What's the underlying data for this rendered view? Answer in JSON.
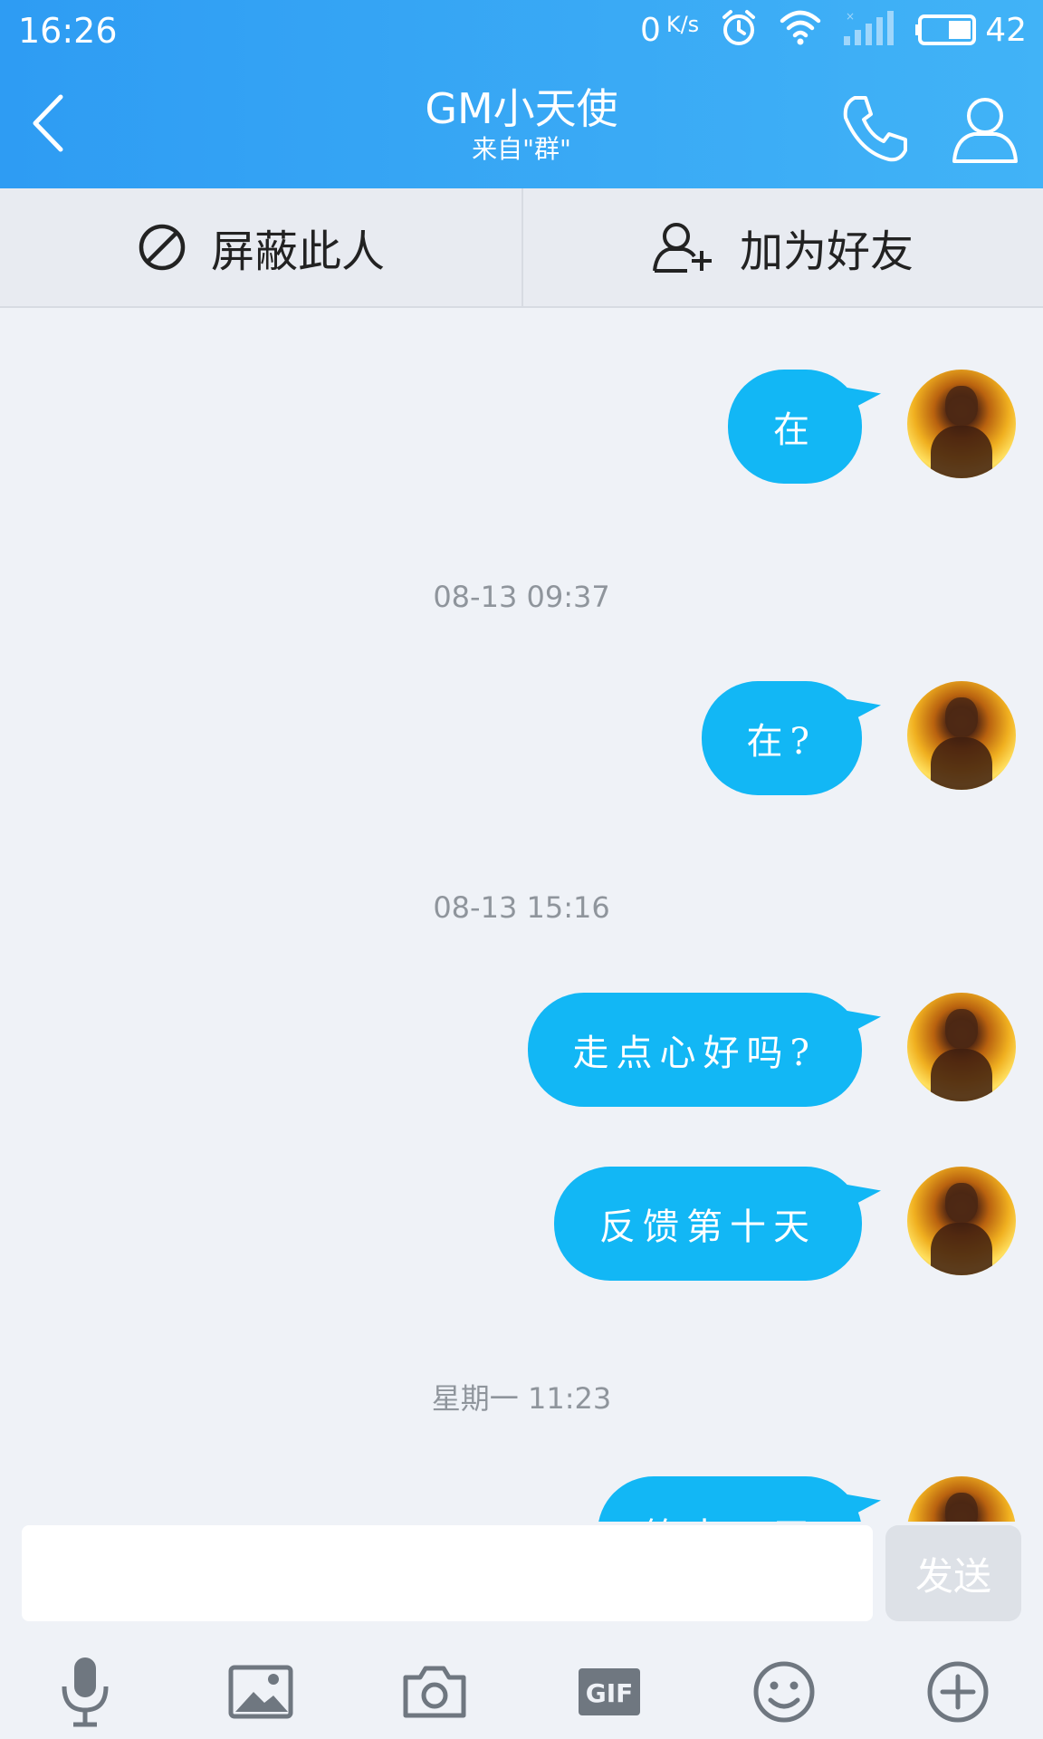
{
  "status_bar": {
    "time": "16:26",
    "net_speed_value": "0",
    "net_speed_unit": "K/s",
    "battery_percent": "42",
    "icons": [
      "alarm-icon",
      "wifi-icon",
      "signal-icon",
      "battery-icon"
    ]
  },
  "header": {
    "title": "GM小天使",
    "subtitle": "来自\"群\"",
    "buttons": [
      "back-icon",
      "phone-icon",
      "profile-icon"
    ]
  },
  "actions": {
    "block_label": "屏蔽此人",
    "add_friend_label": "加为好友"
  },
  "messages": [
    {
      "text": "在"
    },
    {
      "timestamp": "08-13 09:37"
    },
    {
      "text": "在?"
    },
    {
      "timestamp": "08-13 15:16"
    },
    {
      "text": "走点心好吗?"
    },
    {
      "text": "反馈第十天"
    },
    {
      "timestamp": "星期一 11:23"
    },
    {
      "text": "第十一天"
    }
  ],
  "input": {
    "value": "",
    "send_label": "发送"
  },
  "toolbar": [
    "microphone-icon",
    "image-icon",
    "camera-icon",
    "gif-icon",
    "emoji-icon",
    "plus-icon"
  ],
  "colors": {
    "header": "#2e9cf3",
    "bubble": "#12b7f5",
    "background": "#eff2f7"
  }
}
